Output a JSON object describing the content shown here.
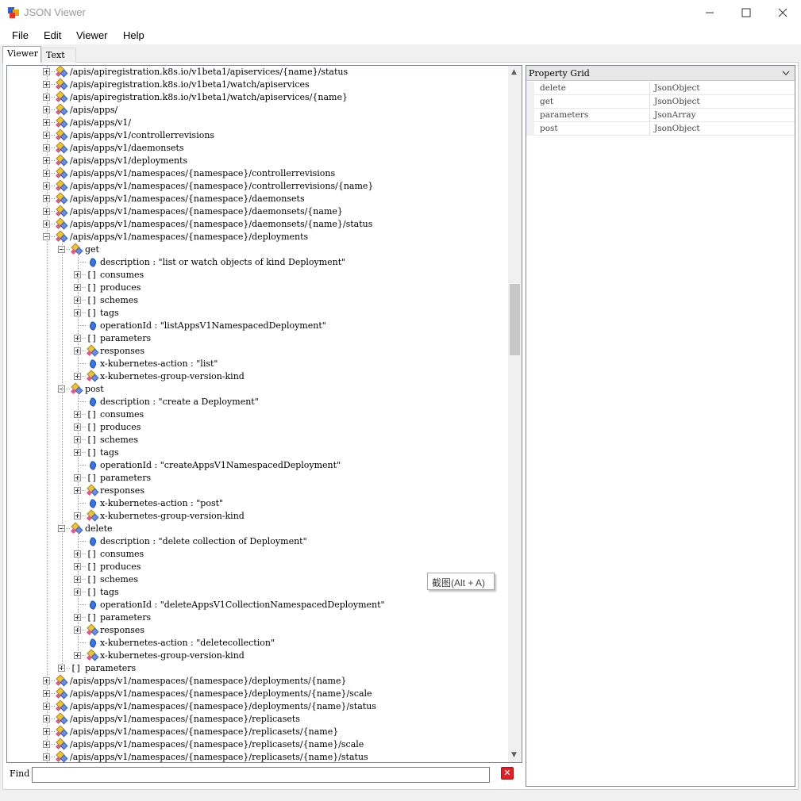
{
  "window": {
    "title": "JSON Viewer"
  },
  "menu": [
    "File",
    "Edit",
    "Viewer",
    "Help"
  ],
  "tabs": {
    "viewer": "Viewer",
    "text": "Text"
  },
  "tree": [
    {
      "depth": 0,
      "kind": "obj",
      "exp": "+",
      "label": "/apis/apiregistration.k8s.io/v1beta1/apiservices/{name}/status"
    },
    {
      "depth": 0,
      "kind": "obj",
      "exp": "+",
      "label": "/apis/apiregistration.k8s.io/v1beta1/watch/apiservices"
    },
    {
      "depth": 0,
      "kind": "obj",
      "exp": "+",
      "label": "/apis/apiregistration.k8s.io/v1beta1/watch/apiservices/{name}"
    },
    {
      "depth": 0,
      "kind": "obj",
      "exp": "+",
      "label": "/apis/apps/"
    },
    {
      "depth": 0,
      "kind": "obj",
      "exp": "+",
      "label": "/apis/apps/v1/"
    },
    {
      "depth": 0,
      "kind": "obj",
      "exp": "+",
      "label": "/apis/apps/v1/controllerrevisions"
    },
    {
      "depth": 0,
      "kind": "obj",
      "exp": "+",
      "label": "/apis/apps/v1/daemonsets"
    },
    {
      "depth": 0,
      "kind": "obj",
      "exp": "+",
      "label": "/apis/apps/v1/deployments"
    },
    {
      "depth": 0,
      "kind": "obj",
      "exp": "+",
      "label": "/apis/apps/v1/namespaces/{namespace}/controllerrevisions"
    },
    {
      "depth": 0,
      "kind": "obj",
      "exp": "+",
      "label": "/apis/apps/v1/namespaces/{namespace}/controllerrevisions/{name}"
    },
    {
      "depth": 0,
      "kind": "obj",
      "exp": "+",
      "label": "/apis/apps/v1/namespaces/{namespace}/daemonsets"
    },
    {
      "depth": 0,
      "kind": "obj",
      "exp": "+",
      "label": "/apis/apps/v1/namespaces/{namespace}/daemonsets/{name}"
    },
    {
      "depth": 0,
      "kind": "obj",
      "exp": "+",
      "label": "/apis/apps/v1/namespaces/{namespace}/daemonsets/{name}/status"
    },
    {
      "depth": 0,
      "kind": "obj",
      "exp": "-",
      "label": "/apis/apps/v1/namespaces/{namespace}/deployments"
    },
    {
      "depth": 1,
      "kind": "obj",
      "exp": "-",
      "label": "get"
    },
    {
      "depth": 2,
      "kind": "val",
      "exp": "",
      "label": "description : \"list or watch objects of kind Deployment\""
    },
    {
      "depth": 2,
      "kind": "arr",
      "exp": "+",
      "label": "consumes"
    },
    {
      "depth": 2,
      "kind": "arr",
      "exp": "+",
      "label": "produces"
    },
    {
      "depth": 2,
      "kind": "arr",
      "exp": "+",
      "label": "schemes"
    },
    {
      "depth": 2,
      "kind": "arr",
      "exp": "+",
      "label": "tags"
    },
    {
      "depth": 2,
      "kind": "val",
      "exp": "",
      "label": "operationId : \"listAppsV1NamespacedDeployment\""
    },
    {
      "depth": 2,
      "kind": "arr",
      "exp": "+",
      "label": "parameters"
    },
    {
      "depth": 2,
      "kind": "obj",
      "exp": "+",
      "label": "responses"
    },
    {
      "depth": 2,
      "kind": "val",
      "exp": "",
      "label": "x-kubernetes-action : \"list\""
    },
    {
      "depth": 2,
      "kind": "obj",
      "exp": "+",
      "label": "x-kubernetes-group-version-kind"
    },
    {
      "depth": 1,
      "kind": "obj",
      "exp": "-",
      "label": "post"
    },
    {
      "depth": 2,
      "kind": "val",
      "exp": "",
      "label": "description : \"create a Deployment\""
    },
    {
      "depth": 2,
      "kind": "arr",
      "exp": "+",
      "label": "consumes"
    },
    {
      "depth": 2,
      "kind": "arr",
      "exp": "+",
      "label": "produces"
    },
    {
      "depth": 2,
      "kind": "arr",
      "exp": "+",
      "label": "schemes"
    },
    {
      "depth": 2,
      "kind": "arr",
      "exp": "+",
      "label": "tags"
    },
    {
      "depth": 2,
      "kind": "val",
      "exp": "",
      "label": "operationId : \"createAppsV1NamespacedDeployment\""
    },
    {
      "depth": 2,
      "kind": "arr",
      "exp": "+",
      "label": "parameters"
    },
    {
      "depth": 2,
      "kind": "obj",
      "exp": "+",
      "label": "responses"
    },
    {
      "depth": 2,
      "kind": "val",
      "exp": "",
      "label": "x-kubernetes-action : \"post\""
    },
    {
      "depth": 2,
      "kind": "obj",
      "exp": "+",
      "label": "x-kubernetes-group-version-kind"
    },
    {
      "depth": 1,
      "kind": "obj",
      "exp": "-",
      "label": "delete"
    },
    {
      "depth": 2,
      "kind": "val",
      "exp": "",
      "label": "description : \"delete collection of Deployment\""
    },
    {
      "depth": 2,
      "kind": "arr",
      "exp": "+",
      "label": "consumes"
    },
    {
      "depth": 2,
      "kind": "arr",
      "exp": "+",
      "label": "produces"
    },
    {
      "depth": 2,
      "kind": "arr",
      "exp": "+",
      "label": "schemes"
    },
    {
      "depth": 2,
      "kind": "arr",
      "exp": "+",
      "label": "tags"
    },
    {
      "depth": 2,
      "kind": "val",
      "exp": "",
      "label": "operationId : \"deleteAppsV1CollectionNamespacedDeployment\""
    },
    {
      "depth": 2,
      "kind": "arr",
      "exp": "+",
      "label": "parameters"
    },
    {
      "depth": 2,
      "kind": "obj",
      "exp": "+",
      "label": "responses"
    },
    {
      "depth": 2,
      "kind": "val",
      "exp": "",
      "label": "x-kubernetes-action : \"deletecollection\""
    },
    {
      "depth": 2,
      "kind": "obj",
      "exp": "+",
      "label": "x-kubernetes-group-version-kind"
    },
    {
      "depth": 1,
      "kind": "arr",
      "exp": "+",
      "label": "parameters"
    },
    {
      "depth": 0,
      "kind": "obj",
      "exp": "+",
      "label": "/apis/apps/v1/namespaces/{namespace}/deployments/{name}"
    },
    {
      "depth": 0,
      "kind": "obj",
      "exp": "+",
      "label": "/apis/apps/v1/namespaces/{namespace}/deployments/{name}/scale"
    },
    {
      "depth": 0,
      "kind": "obj",
      "exp": "+",
      "label": "/apis/apps/v1/namespaces/{namespace}/deployments/{name}/status"
    },
    {
      "depth": 0,
      "kind": "obj",
      "exp": "+",
      "label": "/apis/apps/v1/namespaces/{namespace}/replicasets"
    },
    {
      "depth": 0,
      "kind": "obj",
      "exp": "+",
      "label": "/apis/apps/v1/namespaces/{namespace}/replicasets/{name}"
    },
    {
      "depth": 0,
      "kind": "obj",
      "exp": "+",
      "label": "/apis/apps/v1/namespaces/{namespace}/replicasets/{name}/scale"
    },
    {
      "depth": 0,
      "kind": "obj",
      "exp": "+",
      "label": "/apis/apps/v1/namespaces/{namespace}/replicasets/{name}/status"
    }
  ],
  "find": {
    "label": "Find",
    "value": ""
  },
  "property_grid": {
    "title": "Property Grid",
    "rows": [
      {
        "name": "delete",
        "value": "JsonObject"
      },
      {
        "name": "get",
        "value": "JsonObject"
      },
      {
        "name": "parameters",
        "value": "JsonArray"
      },
      {
        "name": "post",
        "value": "JsonObject"
      }
    ]
  },
  "tooltip": "截图(Alt + A)"
}
